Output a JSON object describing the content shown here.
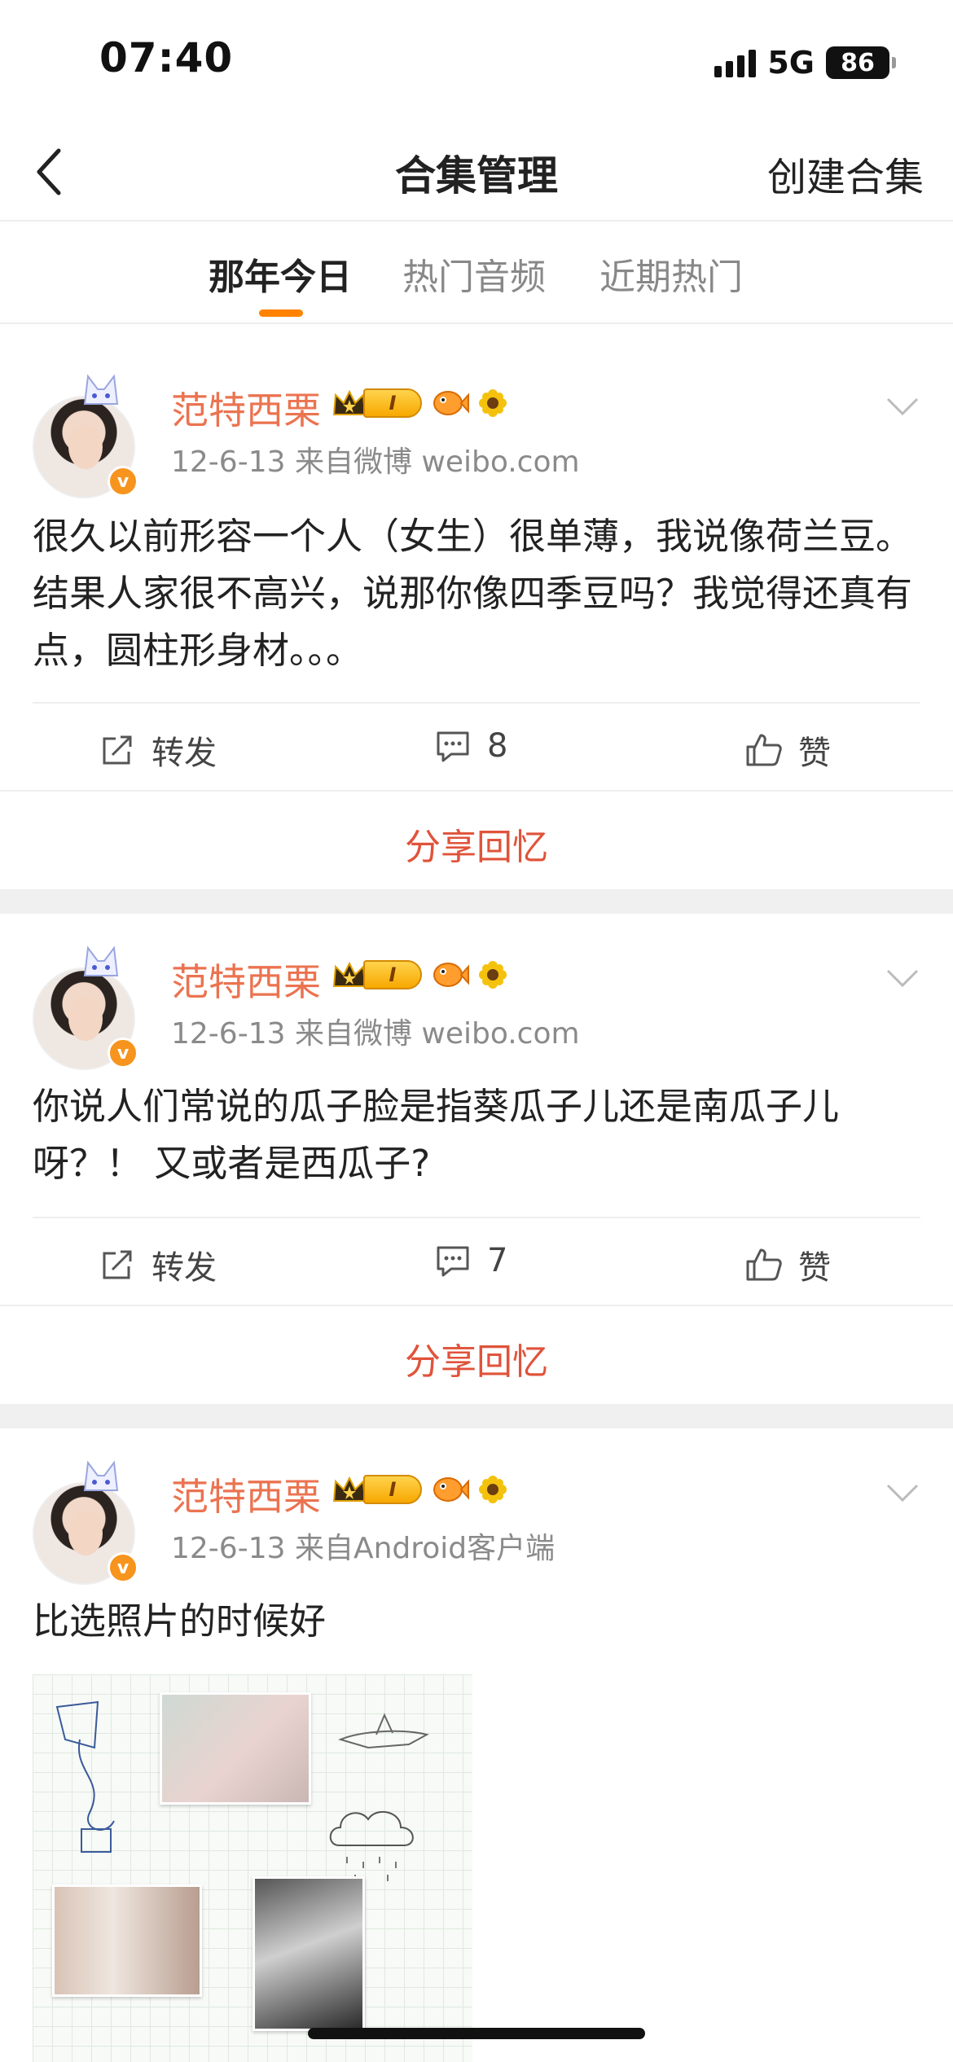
{
  "status_bar": {
    "time": "07:40",
    "network": "5G",
    "battery": "86"
  },
  "nav": {
    "title": "合集管理",
    "action": "创建合集"
  },
  "tabs": [
    {
      "label": "那年今日",
      "active": true
    },
    {
      "label": "热门音频",
      "active": false
    },
    {
      "label": "近期热门",
      "active": false
    }
  ],
  "colors": {
    "accent": "#ff8200",
    "username": "#eb7350",
    "share": "#e0533a"
  },
  "posts": [
    {
      "user": "范特西栗",
      "level": "I",
      "meta": "12-6-13  来自微博 weibo.com",
      "text": "很久以前形容一个人（女生）很单薄，我说像荷兰豆。结果人家很不高兴，说那你像四季豆吗？我觉得还真有点，圆柱形身材。。。",
      "repost_label": "转发",
      "comment_count": "8",
      "like_label": "赞",
      "share_label": "分享回忆"
    },
    {
      "user": "范特西栗",
      "level": "I",
      "meta": "12-6-13  来自微博 weibo.com",
      "text": "你说人们常说的瓜子脸是指葵瓜子儿还是南瓜子儿呀？！ 又或者是西瓜子?",
      "repost_label": "转发",
      "comment_count": "7",
      "like_label": "赞",
      "share_label": "分享回忆"
    },
    {
      "user": "范特西栗",
      "level": "I",
      "meta": "12-6-13  来自Android客户端",
      "text": "比选照片的时候好"
    }
  ]
}
